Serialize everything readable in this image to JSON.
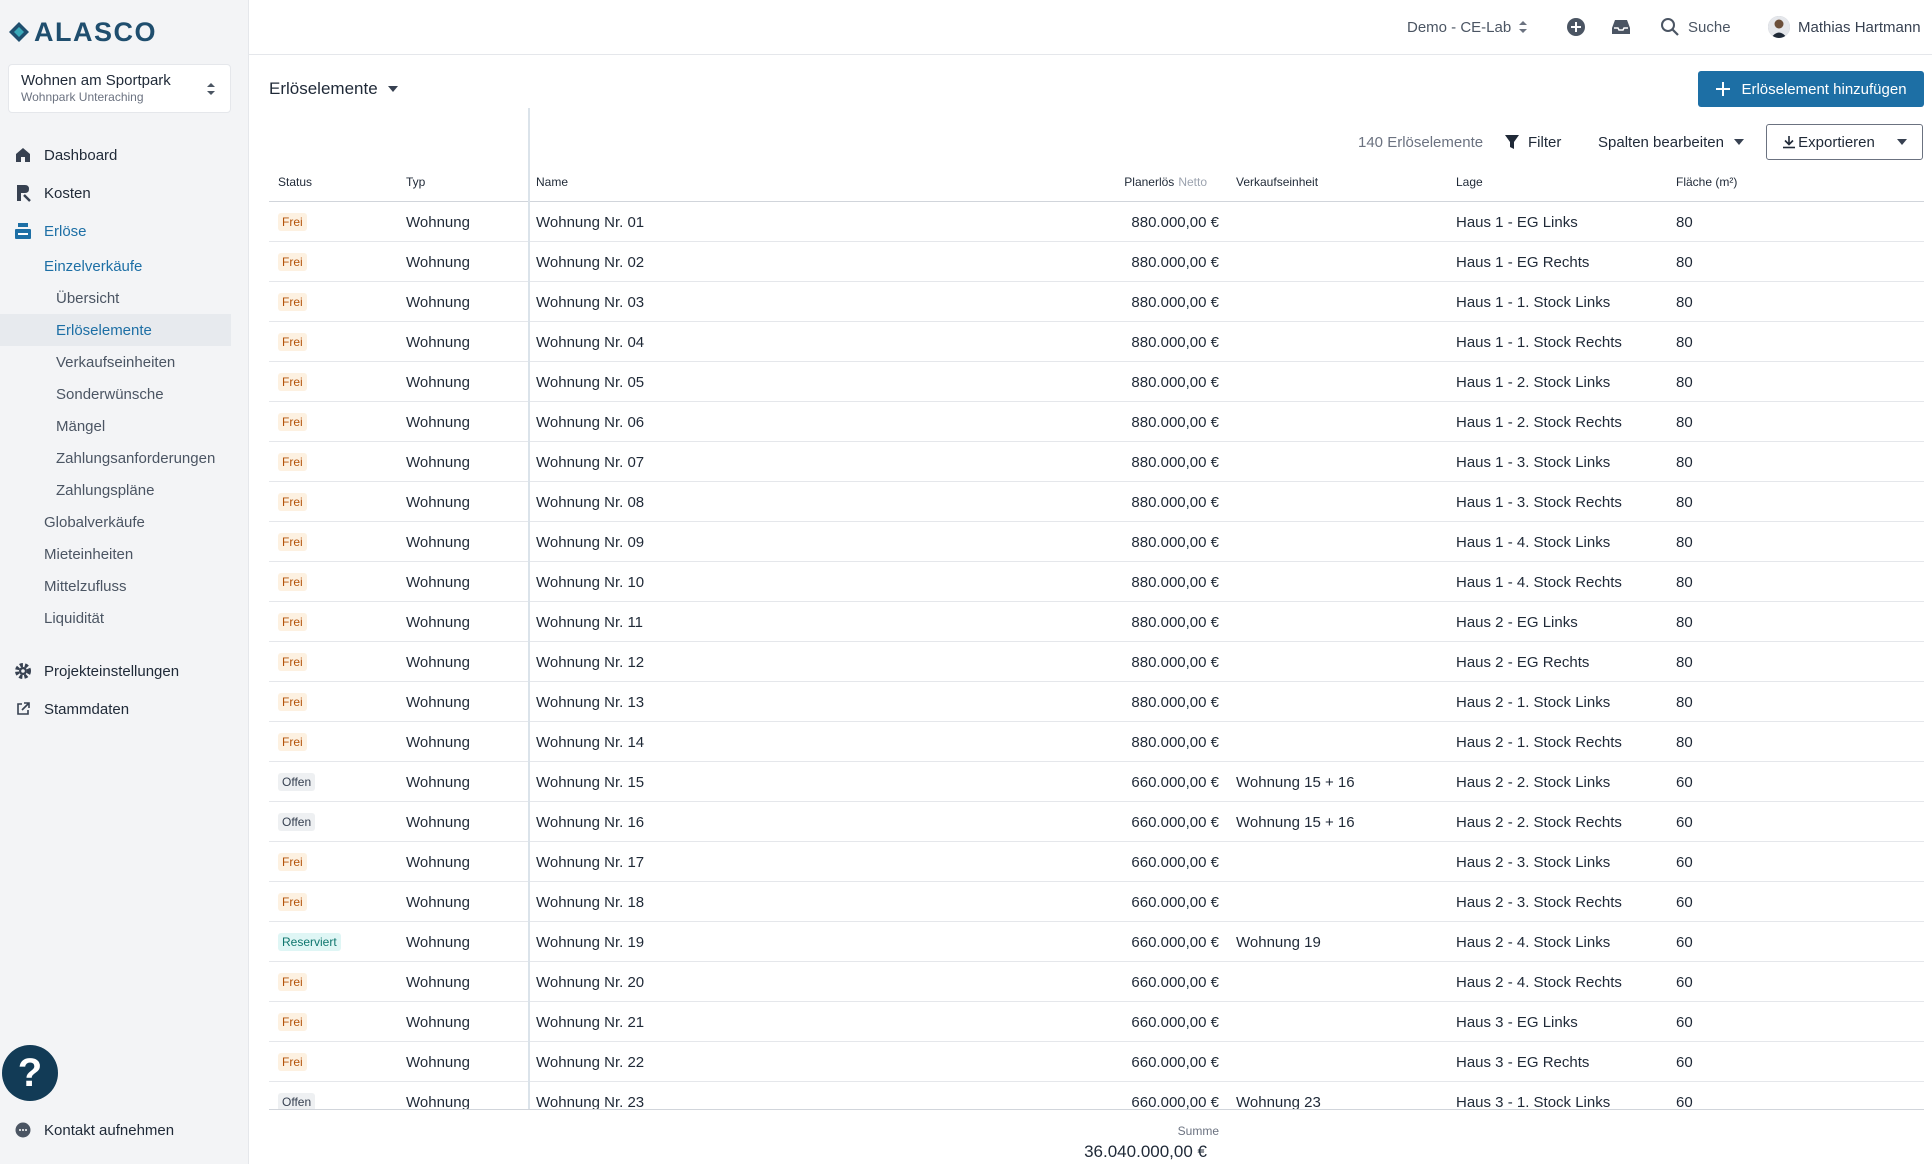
{
  "brand": {
    "name": "ALASCO",
    "color": "#1f4e6e"
  },
  "project": {
    "name": "Wohnen am Sportpark",
    "sub": "Wohnpark Unteraching"
  },
  "nav": {
    "dashboard": "Dashboard",
    "kosten": "Kosten",
    "erloese": "Erlöse",
    "einzelverkaeufe": "Einzelverkäufe",
    "uebersicht": "Übersicht",
    "erloeselemente": "Erlöselemente",
    "verkaufseinheiten": "Verkaufseinheiten",
    "sonderwuensche": "Sonderwünsche",
    "maengel": "Mängel",
    "zahlungsanforderungen": "Zahlungsanforderungen",
    "zahlungsplaene": "Zahlungspläne",
    "globalverkaeufe": "Globalverkäufe",
    "mieteinheiten": "Mieteinheiten",
    "mittelzufluss": "Mittelzufluss",
    "liquiditaet": "Liquidität",
    "projekteinstellungen": "Projekteinstellungen",
    "stammdaten": "Stammdaten"
  },
  "help": {
    "label": "?"
  },
  "contact": {
    "label": "Kontakt aufnehmen"
  },
  "topbar": {
    "environment": "Demo - CE-Lab",
    "search": "Suche",
    "user": "Mathias Hartmann"
  },
  "page": {
    "title": "Erlöselemente",
    "add_button": "Erlöselement hinzufügen",
    "count": "140 Erlöselemente",
    "filter": "Filter",
    "edit_columns": "Spalten bearbeiten",
    "export": "Exportieren"
  },
  "colors": {
    "accent": "#1d6fa5",
    "frei": "#b45309",
    "reserviert": "#0f766e"
  },
  "table": {
    "headers": {
      "status": "Status",
      "typ": "Typ",
      "name": "Name",
      "price": "Planerlös",
      "price_suffix": "Netto",
      "vk": "Verkaufseinheit",
      "lage": "Lage",
      "flaeche": "Fläche (m²)"
    },
    "rows": [
      {
        "status": "Frei",
        "typ": "Wohnung",
        "name": "Wohnung Nr. 01",
        "price": "880.000,00 €",
        "vk": "",
        "lage": "Haus 1 - EG Links",
        "flaeche": "80"
      },
      {
        "status": "Frei",
        "typ": "Wohnung",
        "name": "Wohnung Nr. 02",
        "price": "880.000,00 €",
        "vk": "",
        "lage": "Haus 1 - EG Rechts",
        "flaeche": "80"
      },
      {
        "status": "Frei",
        "typ": "Wohnung",
        "name": "Wohnung Nr. 03",
        "price": "880.000,00 €",
        "vk": "",
        "lage": "Haus 1 - 1. Stock Links",
        "flaeche": "80"
      },
      {
        "status": "Frei",
        "typ": "Wohnung",
        "name": "Wohnung Nr. 04",
        "price": "880.000,00 €",
        "vk": "",
        "lage": "Haus 1 - 1. Stock Rechts",
        "flaeche": "80"
      },
      {
        "status": "Frei",
        "typ": "Wohnung",
        "name": "Wohnung Nr. 05",
        "price": "880.000,00 €",
        "vk": "",
        "lage": "Haus 1 - 2. Stock Links",
        "flaeche": "80"
      },
      {
        "status": "Frei",
        "typ": "Wohnung",
        "name": "Wohnung Nr. 06",
        "price": "880.000,00 €",
        "vk": "",
        "lage": "Haus 1 - 2. Stock Rechts",
        "flaeche": "80"
      },
      {
        "status": "Frei",
        "typ": "Wohnung",
        "name": "Wohnung Nr. 07",
        "price": "880.000,00 €",
        "vk": "",
        "lage": "Haus 1 - 3. Stock Links",
        "flaeche": "80"
      },
      {
        "status": "Frei",
        "typ": "Wohnung",
        "name": "Wohnung Nr. 08",
        "price": "880.000,00 €",
        "vk": "",
        "lage": "Haus 1 - 3. Stock Rechts",
        "flaeche": "80"
      },
      {
        "status": "Frei",
        "typ": "Wohnung",
        "name": "Wohnung Nr. 09",
        "price": "880.000,00 €",
        "vk": "",
        "lage": "Haus 1 - 4. Stock Links",
        "flaeche": "80"
      },
      {
        "status": "Frei",
        "typ": "Wohnung",
        "name": "Wohnung Nr. 10",
        "price": "880.000,00 €",
        "vk": "",
        "lage": "Haus 1 - 4. Stock Rechts",
        "flaeche": "80"
      },
      {
        "status": "Frei",
        "typ": "Wohnung",
        "name": "Wohnung Nr. 11",
        "price": "880.000,00 €",
        "vk": "",
        "lage": "Haus 2 - EG Links",
        "flaeche": "80"
      },
      {
        "status": "Frei",
        "typ": "Wohnung",
        "name": "Wohnung Nr. 12",
        "price": "880.000,00 €",
        "vk": "",
        "lage": "Haus 2 - EG Rechts",
        "flaeche": "80"
      },
      {
        "status": "Frei",
        "typ": "Wohnung",
        "name": "Wohnung Nr. 13",
        "price": "880.000,00 €",
        "vk": "",
        "lage": "Haus 2 - 1. Stock Links",
        "flaeche": "80"
      },
      {
        "status": "Frei",
        "typ": "Wohnung",
        "name": "Wohnung Nr. 14",
        "price": "880.000,00 €",
        "vk": "",
        "lage": "Haus 2 - 1. Stock Rechts",
        "flaeche": "80"
      },
      {
        "status": "Offen",
        "typ": "Wohnung",
        "name": "Wohnung Nr. 15",
        "price": "660.000,00 €",
        "vk": "Wohnung 15 + 16",
        "lage": "Haus 2 - 2. Stock Links",
        "flaeche": "60"
      },
      {
        "status": "Offen",
        "typ": "Wohnung",
        "name": "Wohnung Nr. 16",
        "price": "660.000,00 €",
        "vk": "Wohnung 15 + 16",
        "lage": "Haus 2 - 2. Stock Rechts",
        "flaeche": "60"
      },
      {
        "status": "Frei",
        "typ": "Wohnung",
        "name": "Wohnung Nr. 17",
        "price": "660.000,00 €",
        "vk": "",
        "lage": "Haus 2 - 3. Stock Links",
        "flaeche": "60"
      },
      {
        "status": "Frei",
        "typ": "Wohnung",
        "name": "Wohnung Nr. 18",
        "price": "660.000,00 €",
        "vk": "",
        "lage": "Haus 2 - 3. Stock Rechts",
        "flaeche": "60"
      },
      {
        "status": "Reserviert",
        "typ": "Wohnung",
        "name": "Wohnung Nr. 19",
        "price": "660.000,00 €",
        "vk": "Wohnung 19",
        "lage": "Haus 2 - 4. Stock Links",
        "flaeche": "60"
      },
      {
        "status": "Frei",
        "typ": "Wohnung",
        "name": "Wohnung Nr. 20",
        "price": "660.000,00 €",
        "vk": "",
        "lage": "Haus 2 - 4. Stock Rechts",
        "flaeche": "60"
      },
      {
        "status": "Frei",
        "typ": "Wohnung",
        "name": "Wohnung Nr. 21",
        "price": "660.000,00 €",
        "vk": "",
        "lage": "Haus 3 - EG Links",
        "flaeche": "60"
      },
      {
        "status": "Frei",
        "typ": "Wohnung",
        "name": "Wohnung Nr. 22",
        "price": "660.000,00 €",
        "vk": "",
        "lage": "Haus 3 - EG Rechts",
        "flaeche": "60"
      },
      {
        "status": "Offen",
        "typ": "Wohnung",
        "name": "Wohnung Nr. 23",
        "price": "660.000,00 €",
        "vk": "Wohnung 23",
        "lage": "Haus 3 - 1. Stock Links",
        "flaeche": "60"
      }
    ],
    "footer": {
      "sum_label": "Summe",
      "sum_value": "36.040.000,00 €"
    }
  }
}
